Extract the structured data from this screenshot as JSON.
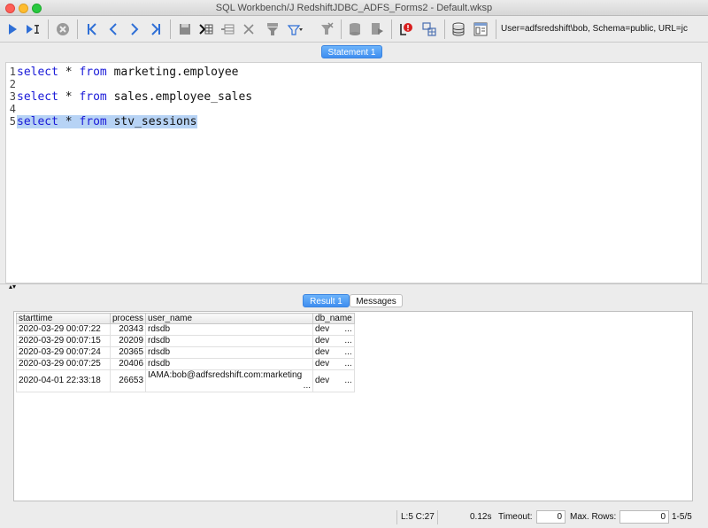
{
  "window": {
    "title": "SQL Workbench/J RedshiftJDBC_ADFS_Forms2 - Default.wksp"
  },
  "toolbar": {
    "connection_info": "User=adfsredshift\\bob, Schema=public, URL=jc",
    "icons": [
      "execute-current-icon",
      "execute-selected-icon",
      "cancel-icon",
      "first-statement-icon",
      "previous-statement-icon",
      "next-statement-icon",
      "last-statement-icon",
      "save-icon",
      "run-to-grid-icon",
      "copy-rows-icon",
      "delete-rows-icon",
      "filter-icon",
      "filter-dropdown-icon",
      "clear-filter-icon",
      "commit-icon",
      "rollback-icon",
      "error-indicator-icon",
      "db-explorer-icon",
      "database-icon",
      "workspace-icon"
    ]
  },
  "editor_tabs": [
    {
      "label": "Statement 1",
      "active": true
    }
  ],
  "editor": {
    "lines": [
      {
        "num": "1",
        "kw1": "select",
        "star": " * ",
        "kw2": "from",
        "rest": " marketing.employee",
        "selected": false
      },
      {
        "num": "2",
        "kw1": "",
        "star": "",
        "kw2": "",
        "rest": "",
        "selected": false
      },
      {
        "num": "3",
        "kw1": "select",
        "star": " * ",
        "kw2": "from",
        "rest": " sales.employee_sales",
        "selected": false
      },
      {
        "num": "4",
        "kw1": "",
        "star": "",
        "kw2": "",
        "rest": "",
        "selected": false
      },
      {
        "num": "5",
        "kw1": "select",
        "star": " * ",
        "kw2": "from",
        "rest": " stv_sessions",
        "selected": true
      }
    ]
  },
  "result_tabs": [
    {
      "label": "Result 1",
      "active": true
    },
    {
      "label": "Messages",
      "active": false
    }
  ],
  "results": {
    "columns": [
      "starttime",
      "process",
      "user_name",
      "db_name"
    ],
    "rows": [
      [
        "2020-03-29 00:07:22",
        "20343",
        "rdsdb",
        "dev"
      ],
      [
        "2020-03-29 00:07:15",
        "20209",
        "rdsdb",
        "dev"
      ],
      [
        "2020-03-29 00:07:24",
        "20365",
        "rdsdb",
        "dev"
      ],
      [
        "2020-03-29 00:07:25",
        "20406",
        "rdsdb",
        "dev"
      ],
      [
        "2020-04-01 22:33:18",
        "26653",
        "IAMA:bob@adfsredshift.com:marketing",
        "dev"
      ]
    ],
    "truncation_marker": "..."
  },
  "status": {
    "cursor": "L:5 C:27",
    "exec_time": "0.12s",
    "timeout_label": "Timeout:",
    "timeout_value": "0",
    "max_rows_label": "Max. Rows:",
    "max_rows_value": "0",
    "row_count": "1-5/5"
  },
  "colors": {
    "keyword": "#1a1ad8",
    "selection": "#b7d3f5",
    "active_tab": "#3f8ef0"
  }
}
